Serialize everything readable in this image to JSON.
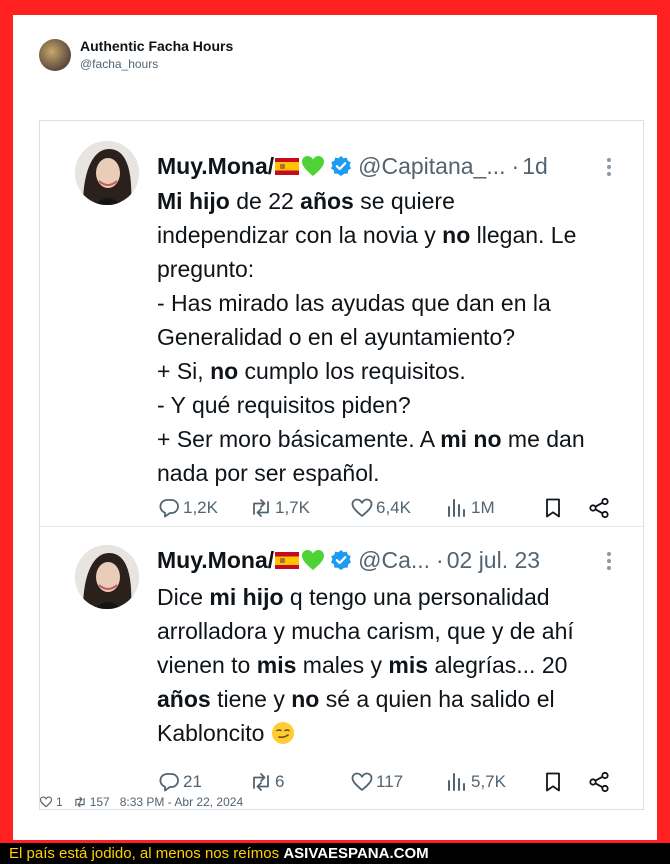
{
  "outer": {
    "author_name": "Authentic Facha Hours",
    "author_handle": "@facha_hours"
  },
  "tweets": [
    {
      "name": "Muy.Mona/",
      "handle": "@Capitana_...",
      "separator": "·",
      "time": "1d",
      "lines": [
        [
          {
            "b": "Mi hijo"
          },
          " de 22 ",
          {
            "b": "años"
          },
          " se quiere"
        ],
        [
          "independizar con la novia y ",
          {
            "b": "no"
          },
          " llegan. Le"
        ],
        [
          "pregunto:"
        ],
        [
          "- Has mirado las ayudas que dan en la"
        ],
        [
          "Generalidad o en el ayuntamiento?"
        ],
        [
          "+ Si, ",
          {
            "b": "no"
          },
          " cumplo los requisitos."
        ],
        [
          "- Y qué requisitos piden?"
        ],
        [
          "+ Ser moro básicamente. A ",
          {
            "b": "mi"
          },
          " ",
          {
            "b": "no"
          },
          " me dan"
        ],
        [
          "nada por ser español."
        ]
      ],
      "replies": "1,2K",
      "retweets": "1,7K",
      "likes": "6,4K",
      "views": "1M"
    },
    {
      "name": "Muy.Mona/",
      "handle": "@Ca...",
      "separator": "·",
      "time": "02 jul. 23",
      "lines": [
        [
          "Dice ",
          {
            "b": "mi hijo"
          },
          " q tengo una personalidad"
        ],
        [
          "arrolladora y mucha carism, que y de ahí"
        ],
        [
          "vienen to ",
          {
            "b": "mis"
          },
          " males y ",
          {
            "b": "mis"
          },
          " alegrías... 20"
        ],
        [
          {
            "b": "años"
          },
          " tiene y ",
          {
            "b": "no"
          },
          " sé a quien ha salido el"
        ],
        [
          "Kabloncito ",
          {
            "emoji": "smirk"
          }
        ]
      ],
      "replies": "21",
      "retweets": "6",
      "likes": "117",
      "views": "5,7K"
    }
  ],
  "footer": {
    "likes": "1",
    "retweets": "157",
    "datetime": "8:33 PM - Abr 22, 2024"
  },
  "banner": {
    "slogan": "El país está jodido, al menos nos reímos",
    "site": "ASIVAESPANA.COM"
  },
  "colors": {
    "frame": "#ff2020",
    "text": "#0f1419",
    "muted": "#536471",
    "verified": "#1d9bf0"
  },
  "icons": [
    "reply-icon",
    "retweet-icon",
    "like-icon",
    "views-icon",
    "bookmark-icon",
    "share-icon",
    "verified-icon",
    "spain-flag-icon",
    "green-heart-icon",
    "more-icon",
    "smirk-emoji"
  ]
}
